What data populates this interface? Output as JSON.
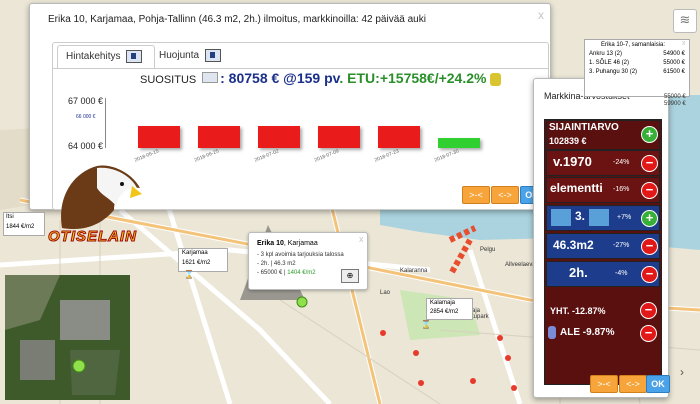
{
  "main_popup": {
    "title": "Erika 10, Karjamaa, Pohja-Tallinn (46.3 m2, 2h.) ilmoitus, markkinoilla: 42 päivää auki",
    "close": "x",
    "tabs": [
      {
        "label": "Hintakehitys"
      },
      {
        "label": "Huojunta"
      }
    ],
    "recommendation": {
      "label": "SUOSITUS",
      "value": ": 80758 € @159 pv",
      "etu": ". ETU:+15758€/+24.2%"
    },
    "buttons": {
      "shrink": ">-<",
      "expand": "<->",
      "ok": "OK"
    }
  },
  "chart_data": {
    "type": "bar",
    "categories": [
      "2018-06-15",
      "2018-06-25",
      "2018-07-02",
      "2018-07-09",
      "2018-07-23",
      "2018-07-30"
    ],
    "values": [
      65000,
      65000,
      65000,
      65000,
      65000,
      64200
    ],
    "y_ticks": [
      "67 000 €",
      "66 000 €",
      "64 000 €"
    ],
    "ylim": [
      64000,
      67000
    ],
    "colors": [
      "#ea1b1b",
      "#ea1b1b",
      "#ea1b1b",
      "#ea1b1b",
      "#ea1b1b",
      "#2fd02f"
    ]
  },
  "side_popup": {
    "title": "Markkina-arvostukset",
    "close": "x",
    "market_value": {
      "label": "SIJAINTIARVO",
      "value": "102839 €"
    },
    "rows": [
      {
        "label": "v.1970",
        "pct": "-24%",
        "sign": "-"
      },
      {
        "label": "elementti",
        "pct": "-16%",
        "sign": "-"
      },
      {
        "label": "3.",
        "pct": "+7%",
        "sign": "+"
      },
      {
        "label": "46.3m2",
        "pct": "-27%",
        "sign": "-"
      },
      {
        "label": "2h.",
        "pct": "-4%",
        "sign": "-"
      }
    ],
    "total": "YHT. -12.87%",
    "ale": "ALE -9.87%",
    "buttons": {
      "shrink": ">-<",
      "expand": "<->",
      "ok": "OK"
    }
  },
  "logo_text": "OTISELAIN",
  "listings_box": {
    "title": "Erika 10-7, samanlaisia:",
    "close": "x",
    "items": [
      {
        "label": "Ankru 13 (2)",
        "price": "54900 €"
      },
      {
        "label": "1. SÕLE 46 (2)",
        "price": "55000 €"
      },
      {
        "label": "3. Puhangu 30 (2)",
        "price": "61500 €"
      }
    ],
    "extra": [
      "55000 €",
      "59900 €"
    ]
  },
  "map_popup": {
    "title": "Erika 10",
    "subtitle": ", Karjamaa",
    "close": "x",
    "lines": [
      "- 3 kpl avoimia tarjouksia talossa",
      "- 2h. | 46.3 m2",
      "- 65000 €"
    ],
    "price_m2": "1404 €/m2"
  },
  "map_labels": {
    "karjamaa": {
      "name": "Karjamaa",
      "price": "1621 €/m2"
    },
    "kalamaja": {
      "name": "Kalamaja",
      "price": "2854 €/m2"
    },
    "left_box": {
      "name": "Itsi",
      "price": "1844 €/m2"
    },
    "streets": [
      "Kalaranna",
      "Kalamaja kalmistupark",
      "Pelgu",
      "Allveelaevade",
      "Lao"
    ]
  }
}
